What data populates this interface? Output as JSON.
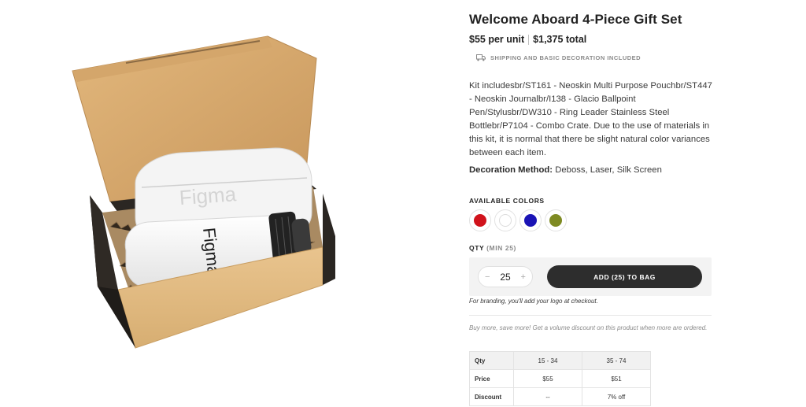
{
  "product": {
    "title": "Welcome Aboard 4-Piece Gift Set",
    "unit_price": "$55 per unit",
    "total_price": "$1,375 total",
    "shipping_note": "SHIPPING AND BASIC DECORATION INCLUDED",
    "description": "Kit includesbr/ST161 - Neoskin Multi Purpose Pouchbr/ST447 - Neoskin Journalbr/I138 - Glacio Ballpoint Pen/Stylusbr/DW310 - Ring Leader Stainless Steel Bottlebr/P7104 - Combo Crate. Due to the use of materials in this kit, it is normal that there be slight natural color variances between each item.",
    "decoration_label": "Decoration Method:",
    "decoration_value": " Deboss, Laser, Silk Screen",
    "image_brand_text": "Figma"
  },
  "colors": {
    "label": "AVAILABLE COLORS",
    "swatches": [
      "#d0121b",
      "#ffffff",
      "#1a13b5",
      "#7e8a22"
    ]
  },
  "quantity": {
    "label": "QTY",
    "min_label": "(MIN 25)",
    "value": "25",
    "minus": "−",
    "plus": "+",
    "add_button": "ADD (25) TO BAG"
  },
  "notes": {
    "branding": "For branding, you'll add your logo at checkout.",
    "volume": "Buy more, save more! Get a volume discount on this product when more are ordered."
  },
  "pricing_table": {
    "rows": [
      [
        "Qty",
        "15 - 34",
        "35 - 74"
      ],
      [
        "Price",
        "$55",
        "$51"
      ],
      [
        "Discount",
        "--",
        "7% off"
      ]
    ]
  }
}
